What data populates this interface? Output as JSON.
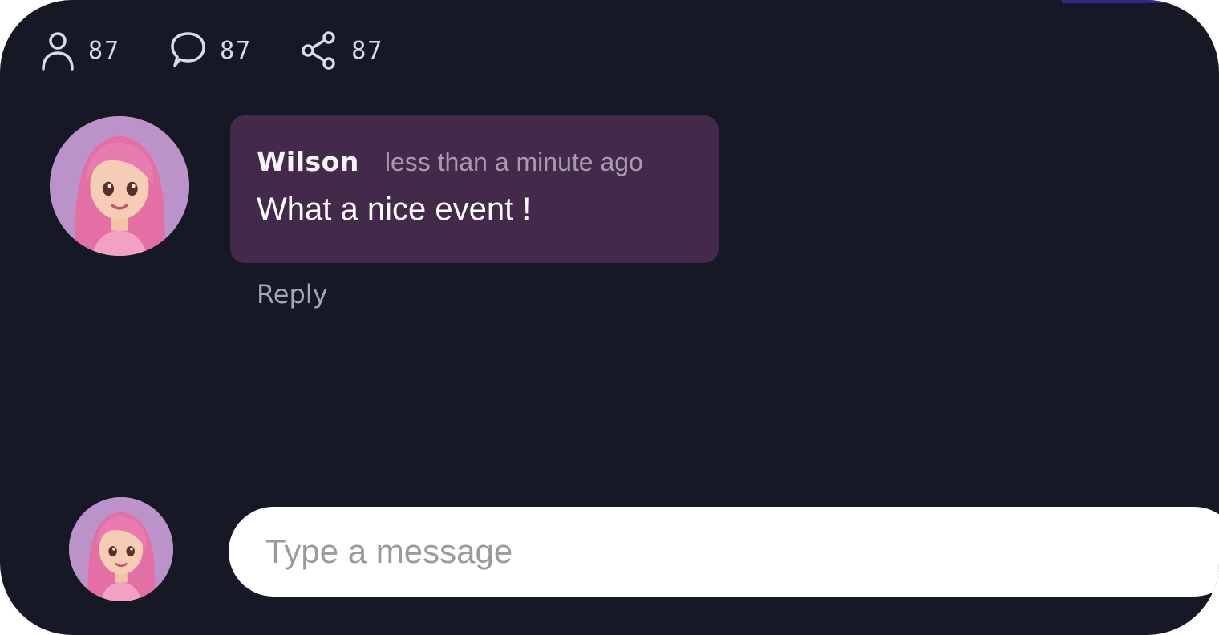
{
  "stats": {
    "participants": {
      "icon": "user-icon",
      "count": "87"
    },
    "comments": {
      "icon": "comment-icon",
      "count": "87"
    },
    "shares": {
      "icon": "share-icon",
      "count": "87"
    }
  },
  "comment": {
    "author": "Wilson",
    "timestamp": "less than a minute ago",
    "text": "What a nice event !",
    "reply_label": "Reply"
  },
  "composer": {
    "placeholder": "Type a message"
  },
  "colors": {
    "background": "#161925",
    "bubble": "#432a4a",
    "accent": "#2b2a8c"
  }
}
